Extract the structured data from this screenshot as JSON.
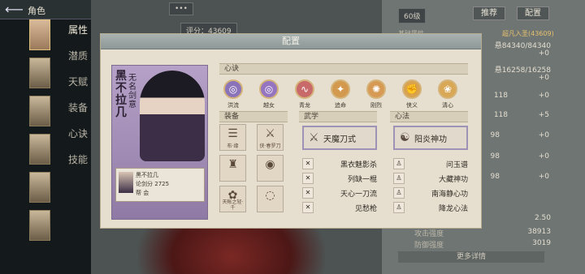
{
  "nav": {
    "title": "角色",
    "tabs": [
      "属性",
      "潜质",
      "天赋",
      "装备",
      "心诀",
      "技能"
    ]
  },
  "topcenter": {
    "dots": "•••",
    "rating": "评分：43609"
  },
  "right": {
    "level": "60级",
    "btn_recommend": "推荐",
    "btn_config": "配置",
    "attr_title": "基础属性",
    "realm": "超凡入圣(43609)",
    "rows": [
      "悬84340/84340",
      "+0",
      "悬16258/16258",
      "+0"
    ],
    "grid": [
      [
        "118",
        "+0"
      ],
      [
        "118",
        "+5"
      ],
      [
        "98",
        "+0"
      ],
      [
        "98",
        "+0"
      ],
      [
        "98",
        "+0"
      ]
    ],
    "bottom": [
      [
        "",
        "2.50"
      ],
      [
        "攻击强度",
        "38913"
      ],
      [
        "防御强度",
        "3019"
      ]
    ],
    "more": "更多详情"
  },
  "modal": {
    "title": "配置",
    "card": {
      "name": "黑不拉几",
      "sub": "无名剑意",
      "info_name": "黑不拉几",
      "info_score_label": "论剑分",
      "info_score": "2725",
      "info_team": "帮 会"
    },
    "xinjue": {
      "label": "心诀",
      "skills": [
        {
          "name": "洪流",
          "icon": "swirl"
        },
        {
          "name": "越女",
          "icon": "swirl"
        },
        {
          "name": "青龙",
          "icon": "dragon"
        },
        {
          "name": "追命",
          "icon": "chase"
        },
        {
          "name": "刚烈",
          "icon": "fire"
        },
        {
          "name": "侠义",
          "icon": "fist"
        },
        {
          "name": "清心",
          "icon": "lotus"
        }
      ]
    },
    "zhuangbei": {
      "label": "装备",
      "items": [
        "布·缘",
        "侠·春罗刀",
        "",
        "",
        "天帐之轻·千",
        ""
      ]
    },
    "wuxue": {
      "label": "武学",
      "main": "天魔刀式",
      "list": [
        "黑衣魅影杀",
        "列缺一棍",
        "天心一刀流",
        "见愁枪"
      ]
    },
    "xinfa": {
      "label": "心法",
      "main": "阳炎神功",
      "list": [
        "问玉谱",
        "大藏神功",
        "南海静心功",
        "降龙心法"
      ]
    }
  }
}
